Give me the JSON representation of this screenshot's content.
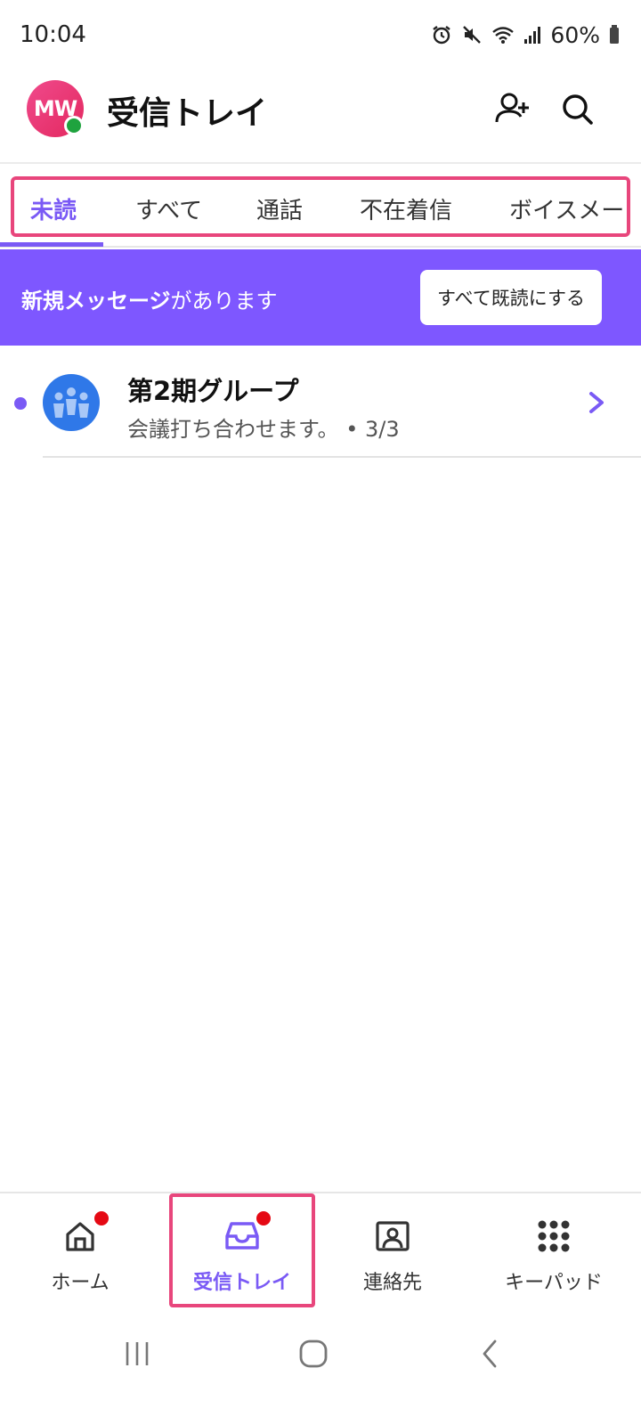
{
  "status_bar": {
    "time": "10:04",
    "battery": "60%",
    "icons": [
      "alarm-icon",
      "mute-icon",
      "wifi-icon",
      "signal-icon",
      "battery-icon"
    ]
  },
  "header": {
    "avatar_initials": "MW",
    "title": "受信トレイ",
    "actions": [
      "add-contact-icon",
      "search-icon"
    ]
  },
  "tabs": {
    "items": [
      {
        "label": "未読",
        "active": true
      },
      {
        "label": "すべて",
        "active": false
      },
      {
        "label": "通話",
        "active": false
      },
      {
        "label": "不在着信",
        "active": false
      },
      {
        "label": "ボイスメー…",
        "active": false
      }
    ]
  },
  "banner": {
    "text_bold": "新規メッセージ",
    "text_rest": "があります",
    "button_label": "すべて既読にする"
  },
  "conversations": [
    {
      "title": "第2期グループ",
      "preview": "会議打ち合わせます。 • 3/3",
      "unread": true
    }
  ],
  "bottom_nav": {
    "items": [
      {
        "label": "ホーム",
        "icon": "home-icon",
        "badge": true,
        "active": false
      },
      {
        "label": "受信トレイ",
        "icon": "inbox-icon",
        "badge": true,
        "active": true
      },
      {
        "label": "連絡先",
        "icon": "contacts-icon",
        "badge": false,
        "active": false
      },
      {
        "label": "キーパッド",
        "icon": "keypad-icon",
        "badge": false,
        "active": false
      }
    ]
  },
  "colors": {
    "accent": "#7a5af5",
    "banner": "#7e57ff",
    "highlight": "#e8467c",
    "badge": "#e50914",
    "avatar": "#e3285f",
    "group_avatar": "#2f78e8",
    "presence": "#1fa33e"
  }
}
